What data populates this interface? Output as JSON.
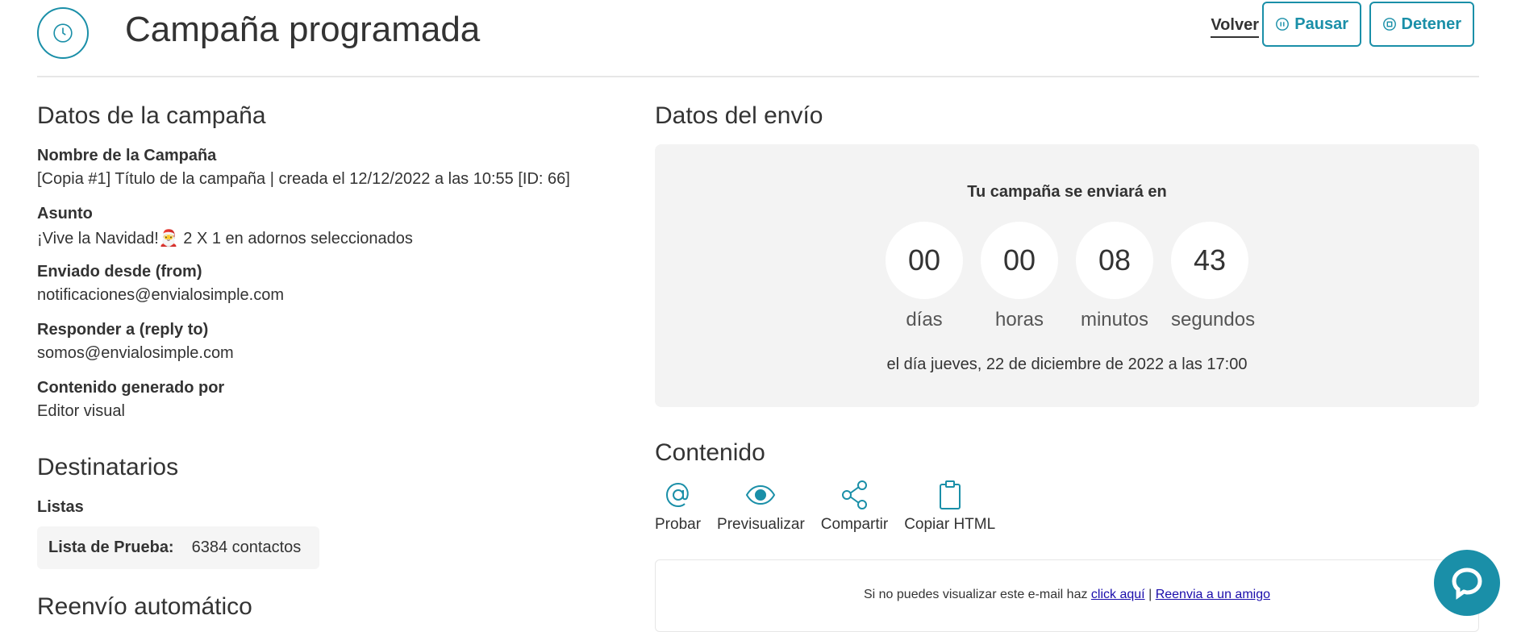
{
  "header": {
    "title": "Campaña programada",
    "back_label": "Volver",
    "pause_label": "Pausar",
    "stop_label": "Detener"
  },
  "campaign": {
    "section_title": "Datos de la campaña",
    "fields": [
      {
        "label": "Nombre de la Campaña",
        "value": "[Copia #1] Título de la campaña | creada el 12/12/2022 a las 10:55 [ID: 66]"
      },
      {
        "label": "Asunto",
        "value": "¡Vive la Navidad!🎅 2 X 1 en adornos seleccionados"
      },
      {
        "label": "Enviado desde (from)",
        "value": "notificaciones@envialosimple.com"
      },
      {
        "label": "Responder a (reply to)",
        "value": "somos@envialosimple.com"
      },
      {
        "label": "Contenido generado por",
        "value": "Editor visual"
      }
    ]
  },
  "recipients": {
    "section_title": "Destinatarios",
    "lists_label": "Listas",
    "list_name": "Lista de Prueba:",
    "list_count": "6384 contactos"
  },
  "forward": {
    "section_title": "Reenvío automático"
  },
  "shipment": {
    "section_title": "Datos del envío",
    "countdown_title": "Tu campaña se enviará en",
    "units": [
      {
        "value": "00",
        "label": "días"
      },
      {
        "value": "00",
        "label": "horas"
      },
      {
        "value": "08",
        "label": "minutos"
      },
      {
        "value": "43",
        "label": "segundos"
      }
    ],
    "date_text": "el día jueves, 22 de diciembre de 2022 a las 17:00"
  },
  "content": {
    "section_title": "Contenido",
    "tools": [
      {
        "label": "Probar",
        "icon": "at-icon"
      },
      {
        "label": "Previsualizar",
        "icon": "eye-icon"
      },
      {
        "label": "Compartir",
        "icon": "share-icon"
      },
      {
        "label": "Copiar HTML",
        "icon": "clipboard-icon"
      }
    ],
    "preview_prefix": "Si no puedes visualizar este e-mail haz",
    "preview_link1": "click aquí",
    "preview_sep": "|",
    "preview_link2": "Reenvia a un amigo"
  },
  "colors": {
    "accent": "#1a8fa8",
    "panel_bg": "#f3f3f3"
  }
}
